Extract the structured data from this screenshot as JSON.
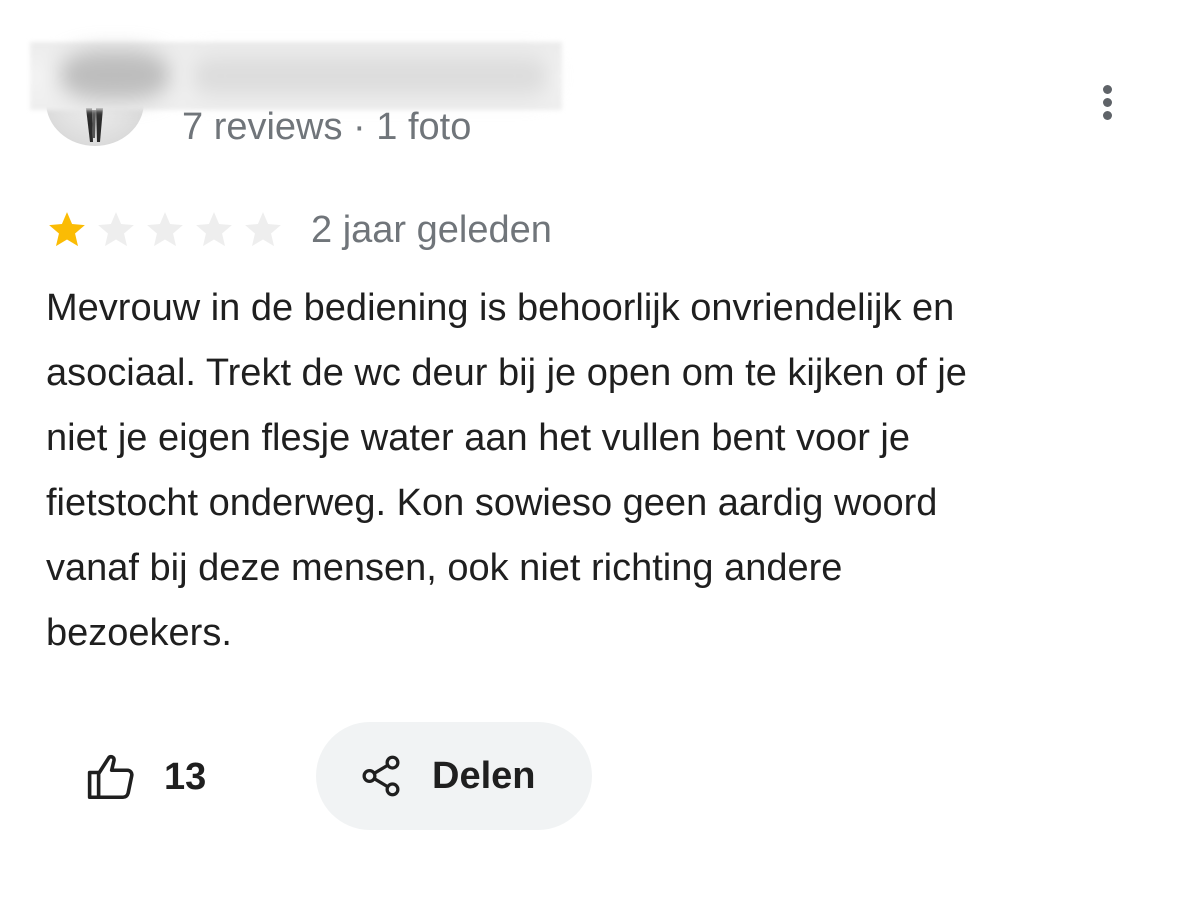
{
  "reviewer": {
    "meta": "7 reviews · 1 foto"
  },
  "rating": {
    "value": 1,
    "max": 5,
    "filled_color": "#fbbc04",
    "empty_color": "#eeeeee"
  },
  "date": "2 jaar geleden",
  "review": {
    "lines": [
      "Mevrouw in de bediening is behoorlijk onvriendelijk en",
      "asociaal. Trekt de wc deur bij je open om te kijken of je",
      "niet je eigen flesje water aan het vullen bent voor je",
      "fietstocht onderweg. Kon sowieso geen aardig woord",
      "vanaf bij deze mensen, ook niet richting andere",
      "bezoekers."
    ]
  },
  "actions": {
    "like_icon": "thumb-up-icon",
    "like_count": "13",
    "share_icon": "share-icon",
    "share_label": "Delen",
    "more_icon": "more-vert-icon"
  }
}
